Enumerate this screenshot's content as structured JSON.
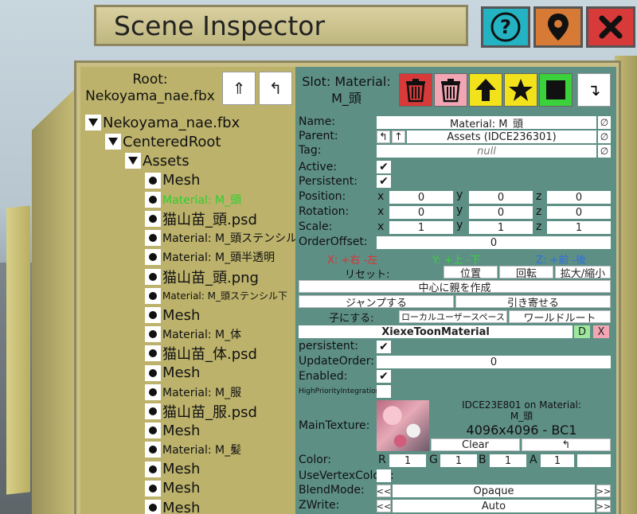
{
  "title": "Scene Inspector",
  "colors": {
    "help_btn": "#23b3c2",
    "location_btn": "#d67a36",
    "close_btn": "#d83a3a",
    "tree_bg": "#bcb26b",
    "inspector_bg": "#5d8f85",
    "selected_text": "#2ecf2e"
  },
  "header_icons": [
    "help-icon",
    "location-pin-icon",
    "close-icon"
  ],
  "hierarchy": {
    "root_label": "Root:",
    "root_name": "Nekoyama_nae.fbx",
    "nodes": [
      {
        "label": "Nekoyama_nae.fbx",
        "level": 0,
        "kind": "expanded",
        "size": "big"
      },
      {
        "label": "CenteredRoot",
        "level": 1,
        "kind": "expanded",
        "size": "big"
      },
      {
        "label": "Assets",
        "level": 2,
        "kind": "expanded",
        "size": "big"
      },
      {
        "label": "Mesh",
        "level": 3,
        "kind": "leaf",
        "size": "big"
      },
      {
        "label": "Material: M_頭",
        "level": 3,
        "kind": "leaf",
        "size": "small",
        "selected": true
      },
      {
        "label": "猫山苗_頭.psd",
        "level": 3,
        "kind": "leaf",
        "size": "big"
      },
      {
        "label": "Material: M_頭ステンシル",
        "level": 3,
        "kind": "leaf",
        "size": "small"
      },
      {
        "label": "Material: M_頭半透明",
        "level": 3,
        "kind": "leaf",
        "size": "small"
      },
      {
        "label": "猫山苗_頭.png",
        "level": 3,
        "kind": "leaf",
        "size": "big"
      },
      {
        "label": "Material: M_頭ステンシル下",
        "level": 3,
        "kind": "leaf",
        "size": "tiny"
      },
      {
        "label": "Mesh",
        "level": 3,
        "kind": "leaf",
        "size": "big"
      },
      {
        "label": "Material: M_体",
        "level": 3,
        "kind": "leaf",
        "size": "small"
      },
      {
        "label": "猫山苗_体.psd",
        "level": 3,
        "kind": "leaf",
        "size": "big"
      },
      {
        "label": "Mesh",
        "level": 3,
        "kind": "leaf",
        "size": "big"
      },
      {
        "label": "Material: M_服",
        "level": 3,
        "kind": "leaf",
        "size": "small"
      },
      {
        "label": "猫山苗_服.psd",
        "level": 3,
        "kind": "leaf",
        "size": "big"
      },
      {
        "label": "Mesh",
        "level": 3,
        "kind": "leaf",
        "size": "big"
      },
      {
        "label": "Material: M_髪",
        "level": 3,
        "kind": "leaf",
        "size": "small"
      },
      {
        "label": "Mesh",
        "level": 3,
        "kind": "leaf",
        "size": "big"
      },
      {
        "label": "Mesh",
        "level": 3,
        "kind": "leaf",
        "size": "big"
      },
      {
        "label": "Mesh",
        "level": 3,
        "kind": "leaf",
        "size": "big"
      }
    ]
  },
  "inspector": {
    "slot_title": "Slot: Material:",
    "slot_name": "M_頭",
    "name_label": "Name:",
    "name_value": "Material: M_頭",
    "parent_label": "Parent:",
    "parent_value": "Assets (IDCE236301)",
    "tag_label": "Tag:",
    "tag_value": "null",
    "null_symbol": "∅",
    "active_label": "Active:",
    "persistent_label": "Persistent:",
    "position_label": "Position:",
    "rotation_label": "Rotation:",
    "scale_label": "Scale:",
    "order_label": "OrderOffset:",
    "axis_x": "x",
    "axis_y": "y",
    "axis_z": "z",
    "position": [
      "0",
      "0",
      "0"
    ],
    "rotation": [
      "0",
      "0",
      "0"
    ],
    "scale": [
      "1",
      "1",
      "1"
    ],
    "order_value": "0",
    "hint_x": "X: +右 -左",
    "hint_y": "Y: +上 -下",
    "hint_z": "Z: +前 -後",
    "hint_colors": [
      "#e03030",
      "#39d33a",
      "#2f6fe0"
    ],
    "reset_label": "リセット:",
    "reset_position": "位置",
    "reset_rotation": "回転",
    "reset_scale": "拡大/縮小",
    "create_parent": "中心に親を作成",
    "jump": "ジャンプする",
    "pull": "引き寄せる",
    "make_child_label": "子にする:",
    "local_user_space": "ローカルユーザースペース",
    "world_root": "ワールドルート",
    "component_name": "XiexeToonMaterial",
    "component_d": "D",
    "component_x": "X",
    "comp_persistent_label": "persistent:",
    "update_order_label": "UpdateOrder:",
    "update_order_value": "0",
    "enabled_label": "Enabled:",
    "high_priority_label": "HighPriorityIntegration:",
    "main_texture_label": "MainTexture:",
    "texture_ref": "IDCE23E801 on Material:",
    "texture_ref_name": "M_頭",
    "texture_size": "4096x4096 - BC1",
    "clear_btn": "Clear",
    "color_label": "Color:",
    "color_r_label": "R",
    "color_g_label": "G",
    "color_b_label": "B",
    "color_a_label": "A",
    "color_values": [
      "1",
      "1",
      "1",
      "1"
    ],
    "use_vertex_colors_label": "UseVertexColors:",
    "blend_mode_label": "BlendMode:",
    "blend_mode_value": "Opaque",
    "zwrite_label": "ZWrite:",
    "zwrite_value": "Auto",
    "prev_symbol": "<<",
    "next_symbol": ">>"
  }
}
